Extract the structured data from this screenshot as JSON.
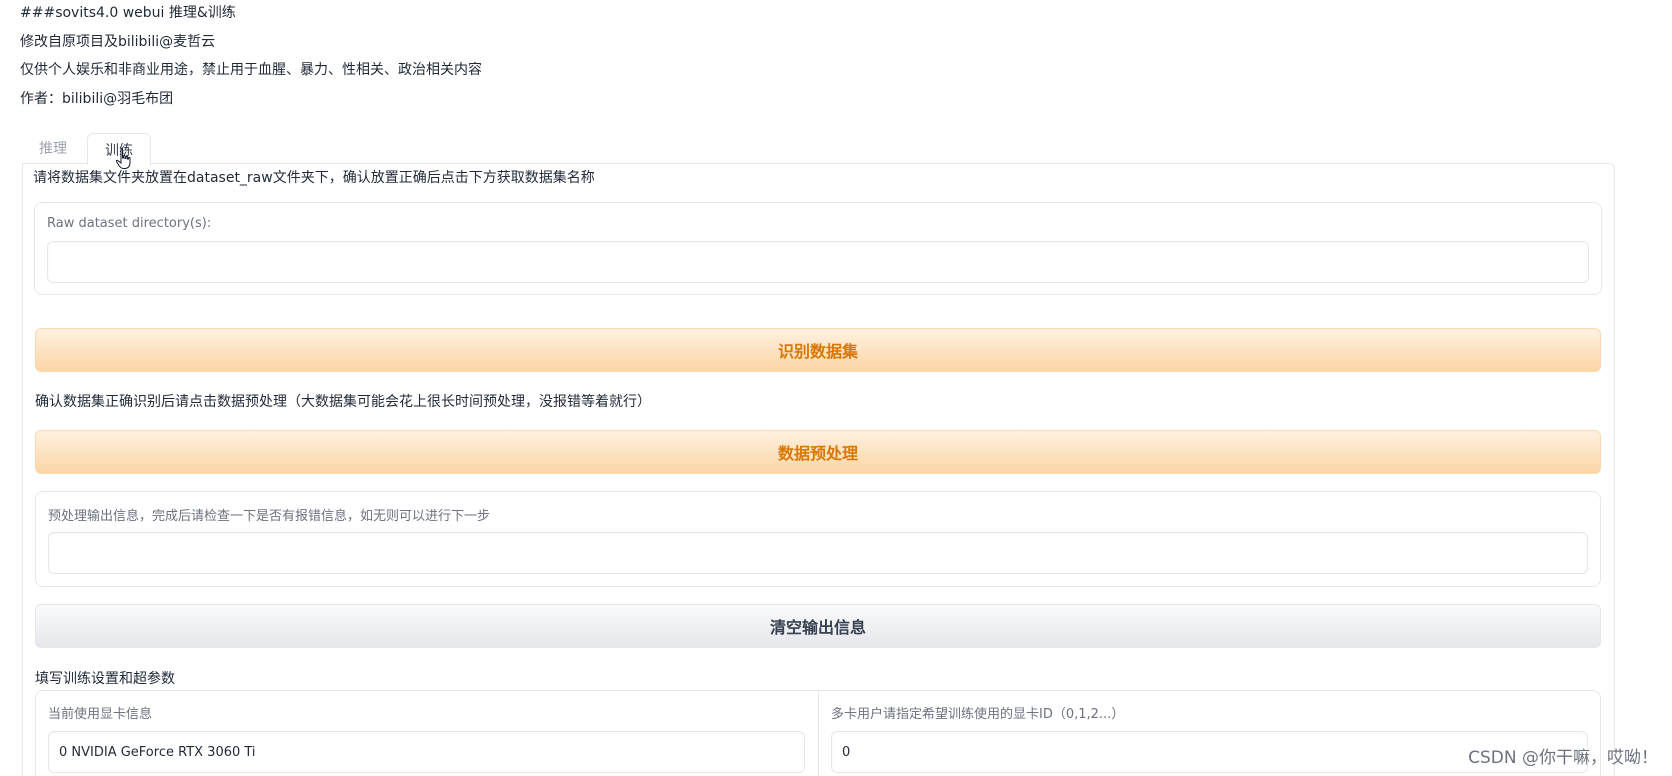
{
  "header": {
    "lines": [
      "###sovits4.0 webui 推理&训练",
      "修改自原项目及bilibili@麦哲云",
      "仅供个人娱乐和非商业用途，禁止用于血腥、暴力、性相关、政治相关内容",
      "作者：bilibili@羽毛布团"
    ]
  },
  "tabs": [
    {
      "label": "推理",
      "active": false
    },
    {
      "label": "训练",
      "active": true
    }
  ],
  "train": {
    "instruction_1": "请将数据集文件夹放置在dataset_raw文件夹下，确认放置正确后点击下方获取数据集名称",
    "raw_dataset": {
      "label": "Raw dataset directory(s):",
      "value": ""
    },
    "identify_button": "识别数据集",
    "instruction_2": "确认数据集正确识别后请点击数据预处理（大数据集可能会花上很长时间预处理，没报错等着就行）",
    "preprocess_button": "数据预处理",
    "preprocess_output": {
      "label": "预处理输出信息，完成后请检查一下是否有报错信息，如无则可以进行下一步",
      "value": ""
    },
    "clear_button": "清空输出信息",
    "instruction_3": "填写训练设置和超参数",
    "gpu_info": {
      "label": "当前使用显卡信息",
      "value": "0 NVIDIA GeForce RTX 3060 Ti"
    },
    "gpu_id": {
      "label": "多卡用户请指定希望训练使用的显卡ID（0,1,2...）",
      "value": "0"
    }
  },
  "watermark": "CSDN @你干嘛，哎呦！",
  "colors": {
    "primary_text": "#d97706",
    "primary_bg_top": "#fff1e0",
    "primary_bg_bottom": "#fbd5a5",
    "border": "#e5e7eb"
  },
  "icons": {
    "cursor": "hand-pointer-icon"
  }
}
